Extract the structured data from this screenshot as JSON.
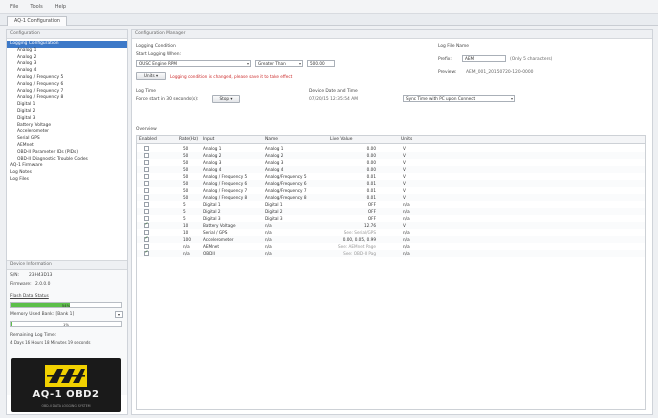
{
  "menu": [
    "File",
    "Tools",
    "Help"
  ],
  "tab": "AQ-1 Configuration",
  "left": {
    "header": "Configuration",
    "tree": [
      {
        "label": "Logging Configuration",
        "selected": true,
        "top": true
      },
      {
        "label": "Analog 1"
      },
      {
        "label": "Analog 2"
      },
      {
        "label": "Analog 3"
      },
      {
        "label": "Analog 4"
      },
      {
        "label": "Analog / Frequency 5"
      },
      {
        "label": "Analog / Frequency 6"
      },
      {
        "label": "Analog / Frequency 7"
      },
      {
        "label": "Analog / Frequency 8"
      },
      {
        "label": "Digital 1"
      },
      {
        "label": "Digital 2"
      },
      {
        "label": "Digital 3"
      },
      {
        "label": "Battery Voltage"
      },
      {
        "label": "Accelerometer"
      },
      {
        "label": "Serial GPS"
      },
      {
        "label": "AEMnet"
      },
      {
        "label": "OBD-II Parameter IDs (PIDs)"
      },
      {
        "label": "OBD-II Diagnostic Trouble Codes"
      },
      {
        "label": "AQ-1 Firmware",
        "top": true
      },
      {
        "label": "Log Notes",
        "top": true
      },
      {
        "label": "Log Files",
        "top": true
      }
    ],
    "device": {
      "header": "Device Information",
      "sn_label": "S/N:",
      "sn_value": "23H43D13",
      "firmware_label": "Firmware:",
      "firmware_value": "2.0.0.0",
      "flash_link": "Flash Data Status",
      "flash_percent": 54,
      "flash_text": "54%",
      "memory_label": "Memory Used Bank: [Bank 1]",
      "memory_percent": 1,
      "memory_text": "1%",
      "remaining_label": "Remaining Log Time:",
      "remaining_value": "4 Days 16 Hours 18 Minutes 19 seconds"
    },
    "logo_title": "AQ-1 OBD2",
    "logo_sub": "OBD-II DATA LOGGING SYSTEM"
  },
  "right": {
    "header": "Configuration Manager",
    "logging_condition_label": "Logging Condition",
    "start_logging_label": "Start Logging When:",
    "condition_select": "OUSC Engine RPM",
    "operator_select": "Greater Than",
    "threshold_value": "500.00",
    "units_select": "Units",
    "warning": "Logging condition is changed, please save it to take effect",
    "log_time_label": "Log Time",
    "force_start_label": "Force start in 30 seconds(s):",
    "force_start_select": "Stop",
    "device_date_label": "Device Date and Time",
    "device_date_value": "07/20/15 12:35:54 AM",
    "sync_select": "Sync Time with PC upon Connect",
    "log_file_name_label": "Log File Name",
    "prefix_label": "Prefix:",
    "prefix_value": "AEM",
    "prefix_note": "(Only 5 characters)",
    "preview_label": "Preview:",
    "preview_value": "AEM_001_20150720-120-0000",
    "overview_label": "Overview",
    "columns": [
      "Enabled",
      "Rate(Hz)",
      "Input",
      "Name",
      "Live Value",
      "Units"
    ],
    "rows": [
      {
        "enabled": false,
        "rate": "50",
        "input": "Analog 1",
        "name": "Analog 1",
        "live": "0.00",
        "units": "V"
      },
      {
        "enabled": false,
        "rate": "50",
        "input": "Analog 2",
        "name": "Analog 2",
        "live": "0.00",
        "units": "V"
      },
      {
        "enabled": false,
        "rate": "50",
        "input": "Analog 3",
        "name": "Analog 3",
        "live": "0.00",
        "units": "V"
      },
      {
        "enabled": false,
        "rate": "50",
        "input": "Analog 4",
        "name": "Analog 4",
        "live": "0.00",
        "units": "V"
      },
      {
        "enabled": false,
        "rate": "50",
        "input": "Analog / Frequency 5",
        "name": "Analog/Frequency 5",
        "live": "0.01",
        "units": "V"
      },
      {
        "enabled": false,
        "rate": "50",
        "input": "Analog / Frequency 6",
        "name": "Analog/Frequency 6",
        "live": "0.01",
        "units": "V"
      },
      {
        "enabled": false,
        "rate": "50",
        "input": "Analog / Frequency 7",
        "name": "Analog/Frequency 7",
        "live": "0.01",
        "units": "V"
      },
      {
        "enabled": false,
        "rate": "50",
        "input": "Analog / Frequency 8",
        "name": "Analog/Frequency 8",
        "live": "0.01",
        "units": "V"
      },
      {
        "enabled": false,
        "rate": "5",
        "input": "Digital 1",
        "name": "Digital 1",
        "live": "OFF",
        "units": "n/a"
      },
      {
        "enabled": false,
        "rate": "5",
        "input": "Digital 2",
        "name": "Digital 2",
        "live": "OFF",
        "units": "n/a"
      },
      {
        "enabled": false,
        "rate": "5",
        "input": "Digital 3",
        "name": "Digital 3",
        "live": "OFF",
        "units": "n/a"
      },
      {
        "enabled": true,
        "rate": "10",
        "input": "Battery Voltage",
        "name": "n/a",
        "live": "12.76",
        "units": "V"
      },
      {
        "enabled": false,
        "rate": "10",
        "input": "Serial / GPS",
        "name": "n/a",
        "live": "See: Serial/GPS",
        "units": "n/a",
        "muted": true
      },
      {
        "enabled": true,
        "rate": "100",
        "input": "Accelerometer",
        "name": "n/a",
        "live": "0.00, 0.05, 0.99",
        "units": "n/a"
      },
      {
        "enabled": false,
        "rate": "n/a",
        "input": "AEMnet",
        "name": "n/a",
        "live": "See: AEMnet Page",
        "units": "n/a",
        "muted": true
      },
      {
        "enabled": true,
        "rate": "n/a",
        "input": "OBDII",
        "name": "n/a",
        "live": "See: OBD-II Pag",
        "units": "n/a",
        "muted": true
      }
    ]
  }
}
